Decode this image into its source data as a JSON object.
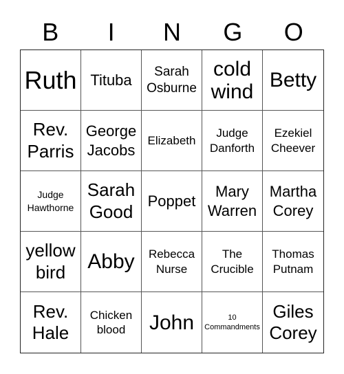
{
  "header": [
    "B",
    "I",
    "N",
    "G",
    "O"
  ],
  "cells": [
    {
      "text": "Ruth",
      "size": "s-xl"
    },
    {
      "text": "Tituba",
      "size": "s-m"
    },
    {
      "text": "Sarah\nOsburne",
      "size": "s-sm"
    },
    {
      "text": "cold\nwind",
      "size": "s-l"
    },
    {
      "text": "Betty",
      "size": "s-l"
    },
    {
      "text": "Rev.\nParris",
      "size": "s-lm"
    },
    {
      "text": "George\nJacobs",
      "size": "s-m"
    },
    {
      "text": "Elizabeth",
      "size": "s-s"
    },
    {
      "text": "Judge\nDanforth",
      "size": "s-s"
    },
    {
      "text": "Ezekiel\nCheever",
      "size": "s-s"
    },
    {
      "text": "Judge\nHawthorne",
      "size": "s-xs"
    },
    {
      "text": "Sarah\nGood",
      "size": "s-lm"
    },
    {
      "text": "Poppet",
      "size": "s-m"
    },
    {
      "text": "Mary\nWarren",
      "size": "s-m"
    },
    {
      "text": "Martha\nCorey",
      "size": "s-m"
    },
    {
      "text": "yellow\nbird",
      "size": "s-lm"
    },
    {
      "text": "Abby",
      "size": "s-l"
    },
    {
      "text": "Rebecca\nNurse",
      "size": "s-s"
    },
    {
      "text": "The\nCrucible",
      "size": "s-s"
    },
    {
      "text": "Thomas\nPutnam",
      "size": "s-s"
    },
    {
      "text": "Rev.\nHale",
      "size": "s-lm"
    },
    {
      "text": "Chicken\nblood",
      "size": "s-s"
    },
    {
      "text": "John",
      "size": "s-l"
    },
    {
      "text": "10\nCommandments",
      "size": "s-xxs"
    },
    {
      "text": "Giles\nCorey",
      "size": "s-lm"
    }
  ]
}
